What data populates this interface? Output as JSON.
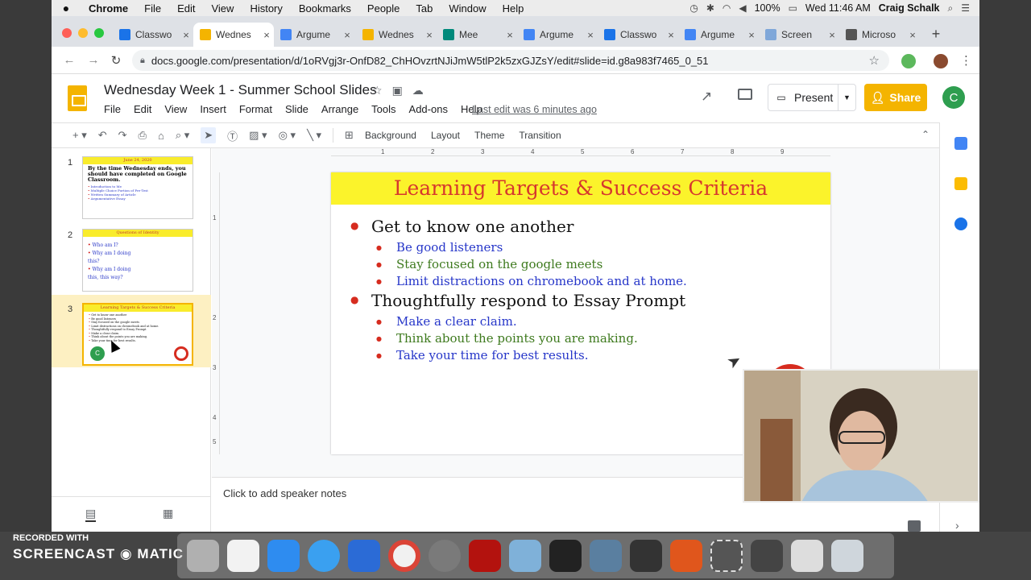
{
  "menubar": {
    "apple": "",
    "items": [
      "Chrome",
      "File",
      "Edit",
      "View",
      "History",
      "Bookmarks",
      "People",
      "Tab",
      "Window",
      "Help"
    ],
    "battery": "100%",
    "datetime": "Wed 11:46 AM",
    "user": "Craig Schalk"
  },
  "tabs": [
    {
      "label": "Classwo",
      "color": "#1a73e8"
    },
    {
      "label": "Wednes",
      "color": "#f4b400"
    },
    {
      "label": "Argume",
      "color": "#4285f4"
    },
    {
      "label": "Wednes",
      "color": "#f4b400"
    },
    {
      "label": "Mee",
      "color": "#00897b"
    },
    {
      "label": "Argume",
      "color": "#4285f4"
    },
    {
      "label": "Classwo",
      "color": "#1a73e8"
    },
    {
      "label": "Argume",
      "color": "#4285f4"
    },
    {
      "label": "Screen",
      "color": "#7fa7d9"
    },
    {
      "label": "Microso",
      "color": "#555555"
    }
  ],
  "omnibox": {
    "url": "docs.google.com/presentation/d/1oRVgj3r-OnfD82_ChHOvzrtNJiJmW5tlP2k5zxGJZsY/edit#slide=id.g8a983f7465_0_51"
  },
  "doc": {
    "title": "Wednesday Week 1 - Summer School Slides",
    "menu": [
      "File",
      "Edit",
      "View",
      "Insert",
      "Format",
      "Slide",
      "Arrange",
      "Tools",
      "Add-ons",
      "Help"
    ],
    "last_edit": "Last edit was 6 minutes ago",
    "present_label": "Present",
    "share_label": "Share",
    "avatar_letter": "C"
  },
  "toolbar": {
    "background": "Background",
    "layout": "Layout",
    "theme": "Theme",
    "transition": "Transition"
  },
  "filmstrip": [
    {
      "num": "1",
      "date": "June 24, 2020",
      "heading": "By the time Wednesday ends, you should have completed on Google Classroom.",
      "lines": [
        "Introduction to Me",
        "Multiple Choice Portion of Pre-Test",
        "Written Summary of Article",
        "Argumentative Essay"
      ]
    },
    {
      "num": "2",
      "title": "Questions of Identity",
      "lines": [
        "Who am I?",
        "Why am I doing this?",
        "Why am I doing this, this way?"
      ]
    },
    {
      "num": "3",
      "title": "Learning Targets & Success Criteria",
      "lines": [
        "Get to know one another",
        "Be good listeners",
        "Stay focused on the google meets",
        "Limit distractions on chromebook and at home.",
        "Thoughtfully respond to Essay Prompt",
        "Make a clear claim.",
        "Think about the points you are making.",
        "Take your time for best results."
      ]
    }
  ],
  "slide": {
    "title": "Learning Targets & Success Criteria",
    "sections": [
      {
        "text": "Get to know one another",
        "items": [
          {
            "text": "Be good listeners",
            "color": "#2636c9"
          },
          {
            "text": "Stay focused on the google meets",
            "color": "#3e7a1e"
          },
          {
            "text": "Limit distractions on chromebook and at home.",
            "color": "#2636c9"
          }
        ]
      },
      {
        "text": "Thoughtfully respond to Essay Prompt",
        "items": [
          {
            "text": "Make a clear claim.",
            "color": "#2636c9"
          },
          {
            "text": "Think about the points you are making.",
            "color": "#3e7a1e"
          },
          {
            "text": "Take your time for best results.",
            "color": "#2636c9"
          }
        ]
      }
    ]
  },
  "ruler": {
    "h": [
      "1",
      "2",
      "3",
      "4",
      "5",
      "6",
      "7",
      "8",
      "9"
    ],
    "v": [
      "1",
      "2",
      "3",
      "4",
      "5"
    ]
  },
  "speaker_notes": "Click to add speaker notes",
  "recorder": {
    "line1": "RECORDED WITH",
    "line2": "SCREENCAST",
    "line3": "MATIC"
  }
}
